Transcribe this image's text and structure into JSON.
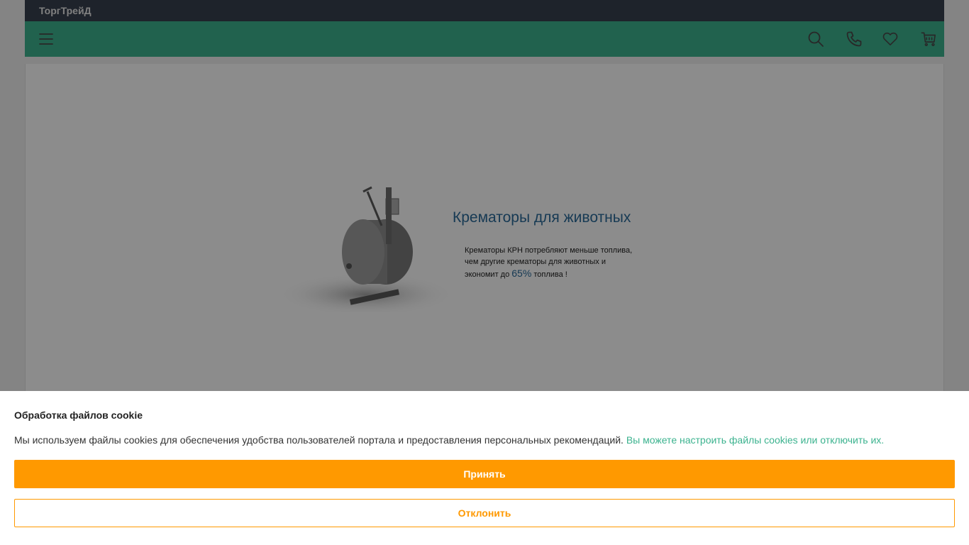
{
  "site": {
    "name": "ТоргТрейД"
  },
  "navbar": {
    "icons": [
      "menu-icon",
      "search-icon",
      "phone-icon",
      "heart-icon",
      "cart-icon"
    ]
  },
  "banner": {
    "title": "Крематоры для животных",
    "text_line1": "Крематоры КРН потребляют меньше топлива,",
    "text_line2": "чем другие крематоры для животных и",
    "text_line3_start": "экономит  до ",
    "percent": "65%",
    "text_line3_end": " топлива !"
  },
  "cookie": {
    "title": "Обработка файлов cookie",
    "text": "Мы используем файлы cookies для обеспечения удобства пользователей портала и предоставления персональных рекомендаций.",
    "link": "Вы можете настроить файлы cookies или отключить их.",
    "accept": "Принять",
    "decline": "Отклонить"
  },
  "colors": {
    "topbar": "#37414f",
    "navbar": "#3cb38f",
    "accent": "#ff9900",
    "link": "#3cb38f"
  }
}
